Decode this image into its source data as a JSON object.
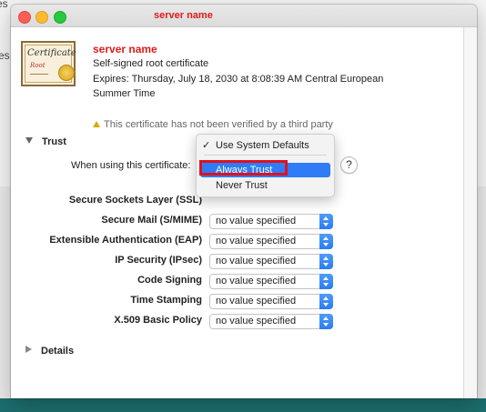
{
  "window": {
    "title": "server name"
  },
  "background": {
    "edge_text_top": "es",
    "edge_text_mid": "es"
  },
  "certificate": {
    "name": "server name",
    "kind": "Self-signed root certificate",
    "expires_line1": "Expires: Thursday, July 18, 2030 at 8:08:39 AM Central European",
    "expires_line2": "Summer Time",
    "warning": "This certificate has not been verified by a third party",
    "icon_text": "Certificate",
    "icon_subtext": "Root"
  },
  "trust": {
    "section_label": "Trust",
    "when_using_label": "When using this certificate:",
    "help_label": "?",
    "menu": {
      "selected": "Use System Defaults",
      "check": "✓",
      "items": [
        "Always Trust",
        "Never Trust"
      ],
      "highlighted": "Always Trust"
    },
    "settings": [
      {
        "label": "Secure Sockets Layer (SSL)",
        "value": ""
      },
      {
        "label": "Secure Mail (S/MIME)",
        "value": "no value specified"
      },
      {
        "label": "Extensible Authentication (EAP)",
        "value": "no value specified"
      },
      {
        "label": "IP Security (IPsec)",
        "value": "no value specified"
      },
      {
        "label": "Code Signing",
        "value": "no value specified"
      },
      {
        "label": "Time Stamping",
        "value": "no value specified"
      },
      {
        "label": "X.509 Basic Policy",
        "value": "no value specified"
      }
    ]
  },
  "details": {
    "section_label": "Details"
  },
  "colors": {
    "accent": "#2f7cf6",
    "title_red": "#e01b1b",
    "annotation_red": "#e0111d"
  }
}
